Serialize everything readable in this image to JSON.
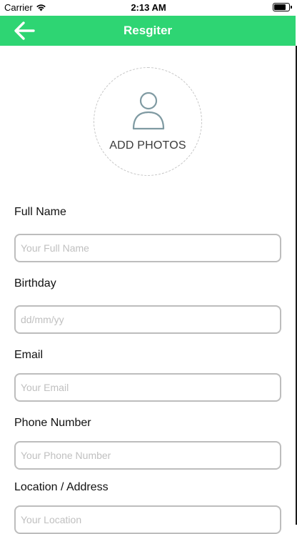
{
  "status_bar": {
    "carrier": "Carrier",
    "time": "2:13 AM",
    "battery_level": 0.9
  },
  "navbar": {
    "title": "Resgiter",
    "back_icon": "arrow-left-icon",
    "bg_color": "#2ed573"
  },
  "photo": {
    "label": "ADD PHOTOS",
    "icon": "user-icon"
  },
  "form": {
    "full_name": {
      "label": "Full Name",
      "placeholder": "Your Full Name",
      "value": ""
    },
    "birthday": {
      "label": "Birthday",
      "placeholder": "dd/mm/yy",
      "value": ""
    },
    "email": {
      "label": "Email",
      "placeholder": "Your Email",
      "value": ""
    },
    "phone": {
      "label": "Phone Number",
      "placeholder": "Your Phone Number",
      "value": ""
    },
    "location": {
      "label": "Location / Address",
      "placeholder": "Your Location",
      "value": ""
    }
  }
}
